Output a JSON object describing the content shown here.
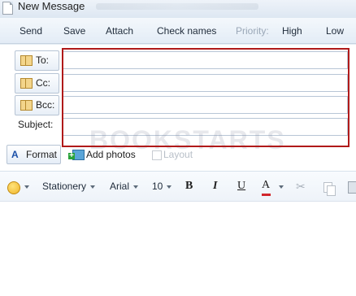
{
  "window": {
    "title": "New Message"
  },
  "command_bar": {
    "send": "Send",
    "save": "Save",
    "attach": "Attach",
    "check_names": "Check names",
    "priority": "Priority:",
    "high": "High",
    "low": "Low"
  },
  "header": {
    "to_label": "To:",
    "cc_label": "Cc:",
    "bcc_label": "Bcc:",
    "subject_label": "Subject:",
    "to_value": "",
    "cc_value": "",
    "bcc_value": "",
    "subject_value": "",
    "watermark": "BOOKSTARTS"
  },
  "action_bar": {
    "format": "Format",
    "add_photos": "Add photos",
    "layout": "Layout"
  },
  "format_toolbar": {
    "stationery": "Stationery",
    "font": "Arial",
    "size": "10",
    "bold": "B",
    "italic": "I",
    "underline": "U",
    "font_color": "A"
  },
  "colors": {
    "highlight_border": "#b01a1a",
    "font_color_bar": "#d1262b"
  }
}
